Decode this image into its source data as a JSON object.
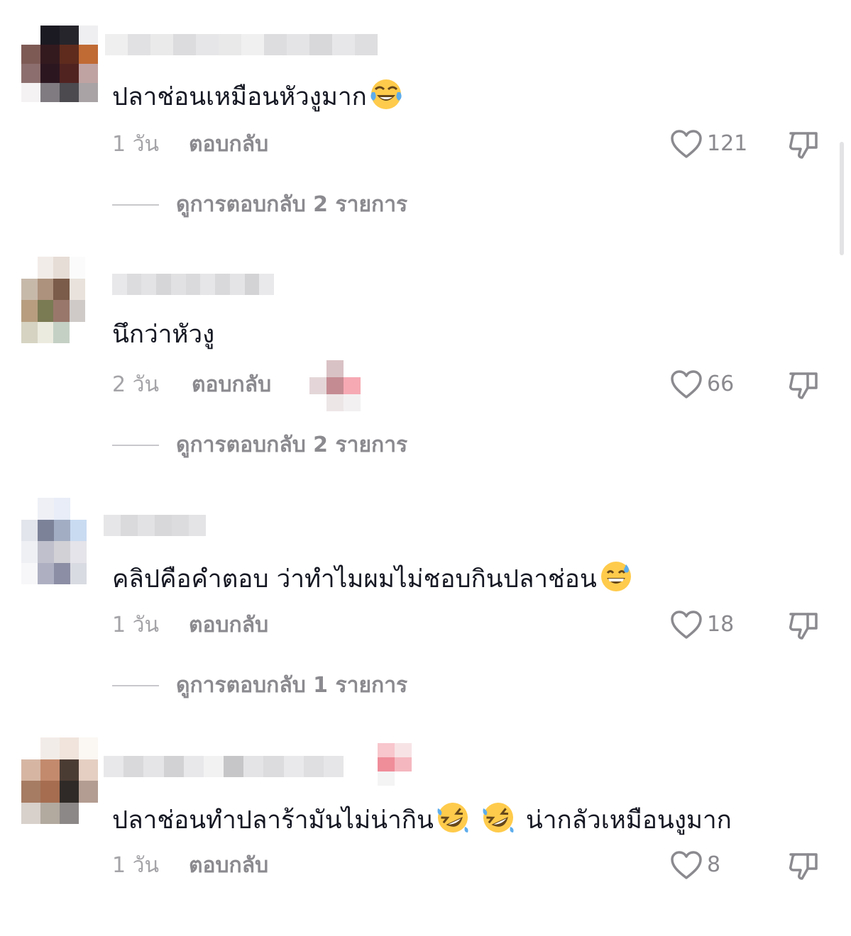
{
  "comments": [
    {
      "text": "ปลาช่อนเหมือนหัวงูมาก",
      "emoji": "face-with-tears-of-joy",
      "time": "1 วัน",
      "reply_label": "ตอบกลับ",
      "likes": "121",
      "view_replies": "ดูการตอบกลับ 2 รายการ",
      "avatar_colors": [
        "#ffffff",
        "#1b1a22",
        "#27252c",
        "#efeff1",
        "#7e5a55",
        "#331a1f",
        "#5e2b1d",
        "#c06a34",
        "#8d6e6e",
        "#2b1620",
        "#512320",
        "#bfa3a2",
        "#f5f2f3",
        "#7f7b80",
        "#4c4a4f",
        "#a9a3a6"
      ],
      "username_colors": [
        "#efeff0",
        "#e1e1e3",
        "#eaeaeb",
        "#dcdcde",
        "#e6e6e8",
        "#e9e9ea",
        "#f0f0f1",
        "#dddddf",
        "#e4e4e6",
        "#d8d8da",
        "#e7e7e9",
        "#dedee0"
      ]
    },
    {
      "text": "นึกว่าหัวงู",
      "time": "2 วัน",
      "reply_label": "ตอบกลับ",
      "likes": "66",
      "view_replies": "ดูการตอบกลับ 2 รายการ",
      "avatar_colors": [
        "#ffffff",
        "#f2ece8",
        "#e6ddd6",
        "#fbfbfb",
        "#c7b9aa",
        "#ad927d",
        "#7b5b4a",
        "#e9e2dc",
        "#b89e7f",
        "#7a7a53",
        "#99776b",
        "#cfcac8",
        "#d6d3c2",
        "#ecebdf",
        "#c4d0c4",
        "#ffffff"
      ],
      "username_colors": [
        "#e8e8ea",
        "#dcdcde",
        "#e3e3e5",
        "#d6d6d8",
        "#e1e1e3",
        "#dadadc",
        "#e6e6e8",
        "#d9d9db",
        "#e4e4e6",
        "#d3d3d5",
        "#e9e9eb"
      ],
      "sticker_colors": [
        "#ffffff",
        "#d9c2c5",
        "#ffffff",
        "#e4d6d8",
        "#c58b93",
        "#f6a9b3",
        "#ffffff",
        "#ede6e7",
        "#f3f0f1"
      ]
    },
    {
      "text": "คลิปคือคำตอบ ว่าทำไมผมไม่ชอบกินปลาช่อน",
      "emoji": "grinning-face-with-sweat",
      "time": "1 วัน",
      "reply_label": "ตอบกลับ",
      "likes": "18",
      "view_replies": "ดูการตอบกลับ 1 รายการ",
      "avatar_colors": [
        "#ffffff",
        "#eef0f6",
        "#e8edf7",
        "#ffffff",
        "#e3e5ec",
        "#7c8399",
        "#a2adc4",
        "#c9dbf1",
        "#eef0f4",
        "#bfc0cc",
        "#d1d1d6",
        "#e4e4ea",
        "#f7f7f9",
        "#aeb0c2",
        "#8b8ea4",
        "#d9dbe2"
      ],
      "username_colors": [
        "#e6e6e8",
        "#dadadc",
        "#e2e2e4",
        "#d8d8da",
        "#dcdcde",
        "#e4e4e6"
      ]
    },
    {
      "text": "ปลาช่อนทำปลาร้ามันไม่น่ากิน",
      "text_after": "น่ากลัวเหมือนงูมาก",
      "emoji": "rolling-on-the-floor-laughing",
      "time": "1 วัน",
      "reply_label": "ตอบกลับ",
      "likes": "8",
      "avatar_colors": [
        "#ffffff",
        "#f2ece8",
        "#f0e4dc",
        "#fbf7f3",
        "#d6b6a3",
        "#c38a6d",
        "#4b3c33",
        "#e5cfc2",
        "#a67c63",
        "#a66d50",
        "#2f2a27",
        "#b39d92",
        "#d8d0cb",
        "#b2a99f",
        "#8c8887",
        "#ffffff"
      ],
      "username_colors": [
        "#e8e8ea",
        "#d9d9db",
        "#e5e5e7",
        "#d2d2d4",
        "#e8e8ea",
        "#f2f2f3",
        "#c6c6c8",
        "#e4e4e6",
        "#dcdcde",
        "#e9e9eb",
        "#dfdfe1",
        "#e6e6e8"
      ],
      "sticker_colors": [
        "#ffffff",
        "#f8c6cd",
        "#f7e3e6",
        "#ffffff",
        "#ef8d99",
        "#f5b7bf",
        "#ffffff",
        "#f4f4f5",
        "#ffffff"
      ]
    }
  ]
}
